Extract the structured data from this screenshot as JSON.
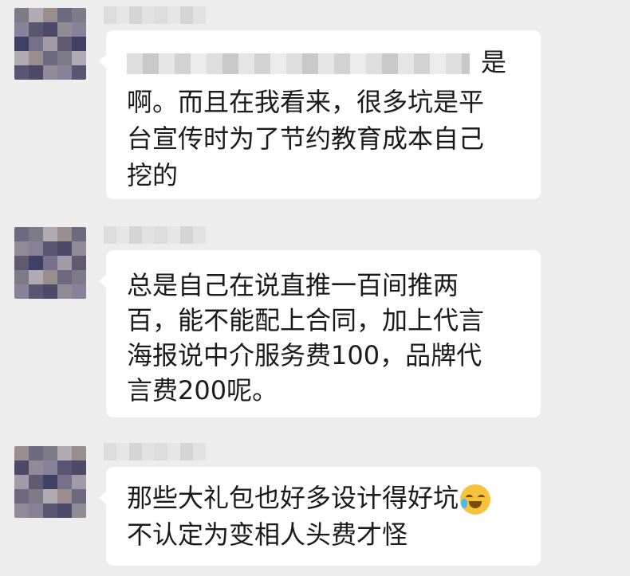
{
  "messages": [
    {
      "sender_redacted": true,
      "lines": [
        {
          "redacted_prefix": true,
          "text": "是"
        },
        {
          "text": "啊。而且在我看来，很多坑是平"
        },
        {
          "text": "台宣传时为了节约教育成本自己"
        },
        {
          "text": "挖的"
        }
      ]
    },
    {
      "sender_redacted": true,
      "lines": [
        {
          "text": "总是自己在说直推一百间推两"
        },
        {
          "text": "百，能不能配上合同，加上代言"
        },
        {
          "text": "海报说中介服务费100，品牌代"
        },
        {
          "text": "言费200呢。"
        }
      ]
    },
    {
      "sender_redacted": true,
      "lines": [
        {
          "text": "那些大礼包也好多设计得好坑",
          "emoji": "face-with-tears-of-joy-icon"
        },
        {
          "text": "不认定为变相人头费才怪"
        }
      ]
    }
  ],
  "colors": {
    "background": "#ededed",
    "bubble": "#ffffff",
    "text": "#1b1b1b"
  }
}
